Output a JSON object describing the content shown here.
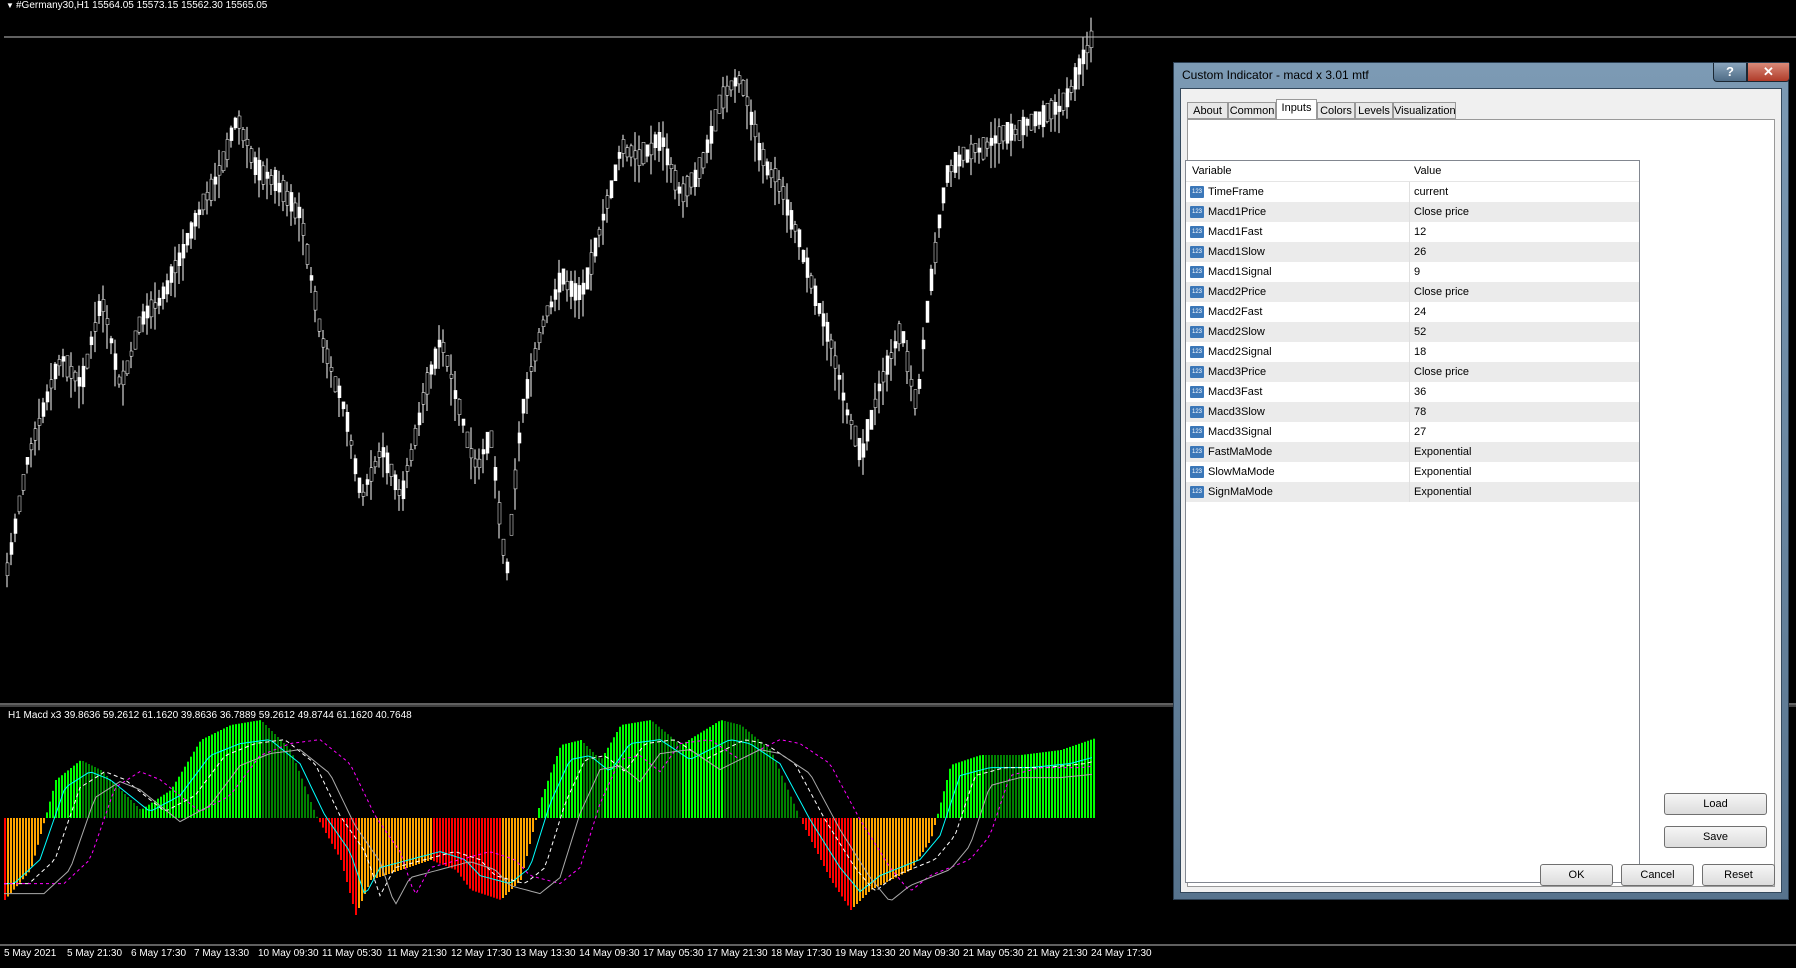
{
  "chart": {
    "symbol_header": "#Germany30,H1  15564.05 15573.15 15562.30 15565.05",
    "indicator_header": "H1 Macd x3 39.8636 59.2612 61.1620 39.8636 36.7889 59.2612 49.8744 61.1620 40.7648",
    "time_labels": [
      "5 May 2021",
      "5 May 21:30",
      "6 May 17:30",
      "7 May 13:30",
      "10 May 09:30",
      "11 May 05:30",
      "11 May 21:30",
      "12 May 17:30",
      "13 May 13:30",
      "14 May 09:30",
      "17 May 05:30",
      "17 May 21:30",
      "18 May 17:30",
      "19 May 13:30",
      "20 May 09:30",
      "21 May 05:30",
      "21 May 21:30",
      "24 May 17:30"
    ],
    "colors": {
      "candle": "#ffffff",
      "histogram_up_strong": "#00ff00",
      "histogram_up": "#008000",
      "histogram_down": "#ff0000",
      "histogram_down_weak": "#ffa500",
      "macd_line1": "#00ffff",
      "signal_line": "#ffffff",
      "slow_line": "#ff00ff",
      "slow_line2": "#aaaaaa"
    }
  },
  "dialog": {
    "title": "Custom Indicator - macd x 3.01 mtf",
    "help_label": "?",
    "close_label": "✕",
    "tabs": [
      "About",
      "Common",
      "Inputs",
      "Colors",
      "Levels",
      "Visualization"
    ],
    "active_tab": "Inputs",
    "columns": {
      "variable": "Variable",
      "value": "Value"
    },
    "rows": [
      {
        "variable": "TimeFrame",
        "value": "current"
      },
      {
        "variable": "Macd1Price",
        "value": "Close price"
      },
      {
        "variable": "Macd1Fast",
        "value": "12"
      },
      {
        "variable": "Macd1Slow",
        "value": "26"
      },
      {
        "variable": "Macd1Signal",
        "value": "9"
      },
      {
        "variable": "Macd2Price",
        "value": "Close price"
      },
      {
        "variable": "Macd2Fast",
        "value": "24"
      },
      {
        "variable": "Macd2Slow",
        "value": "52"
      },
      {
        "variable": "Macd2Signal",
        "value": "18"
      },
      {
        "variable": "Macd3Price",
        "value": "Close price"
      },
      {
        "variable": "Macd3Fast",
        "value": "36"
      },
      {
        "variable": "Macd3Slow",
        "value": "78"
      },
      {
        "variable": "Macd3Signal",
        "value": "27"
      },
      {
        "variable": "FastMaMode",
        "value": "Exponential"
      },
      {
        "variable": "SlowMaMode",
        "value": "Exponential"
      },
      {
        "variable": "SignMaMode",
        "value": "Exponential"
      }
    ],
    "row_icon_label": "123",
    "buttons": {
      "load": "Load",
      "save": "Save",
      "ok": "OK",
      "cancel": "Cancel",
      "reset": "Reset"
    }
  }
}
